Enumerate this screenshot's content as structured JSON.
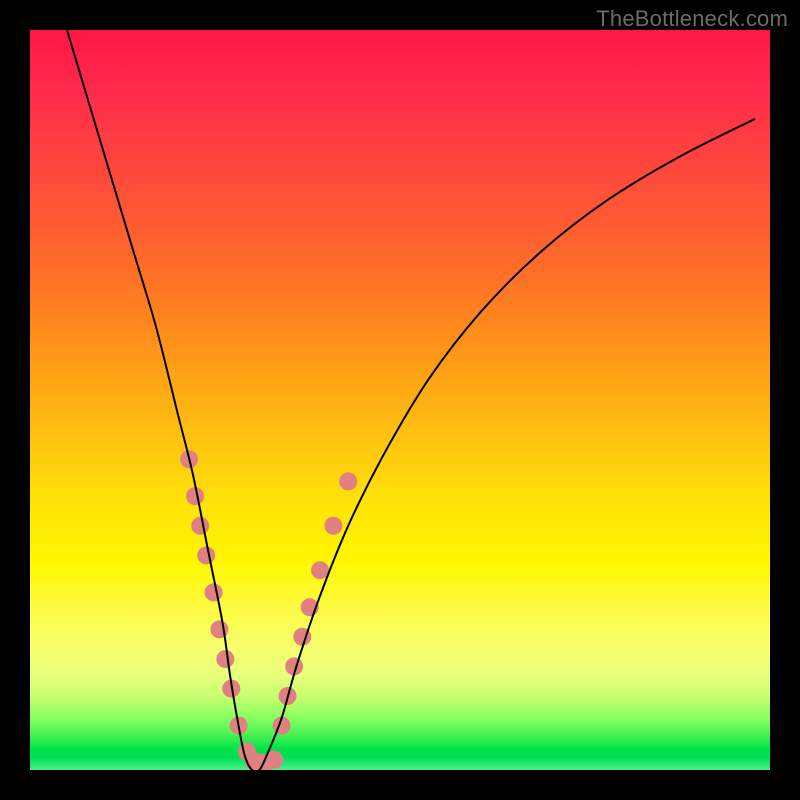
{
  "watermark": "TheBottleneck.com",
  "chart_data": {
    "type": "line",
    "title": "",
    "xlabel": "",
    "ylabel": "",
    "xlim": [
      0,
      100
    ],
    "ylim": [
      0,
      100
    ],
    "grid": false,
    "legend": false,
    "background_gradient": [
      "#ff1744",
      "#ff7a22",
      "#ffe308",
      "#00e24a"
    ],
    "series": [
      {
        "name": "bottleneck-curve",
        "x": [
          5,
          8,
          11,
          14,
          17,
          20,
          22,
          24,
          26,
          27,
          28,
          29,
          30,
          31,
          32,
          34,
          36,
          39,
          43,
          48,
          54,
          61,
          69,
          78,
          88,
          98
        ],
        "values": [
          100,
          90,
          80,
          70,
          60,
          48,
          40,
          30,
          20,
          13,
          7,
          2,
          0,
          0,
          2,
          7,
          14,
          23,
          33,
          43,
          53,
          62,
          70,
          77,
          83,
          88
        ],
        "color": "#000000",
        "stroke_width": 2
      }
    ],
    "markers": [
      {
        "name": "left-branch-dots",
        "color": "#e08080",
        "radius": 9,
        "points": [
          {
            "x": 21.5,
            "y": 42
          },
          {
            "x": 22.3,
            "y": 37
          },
          {
            "x": 23.0,
            "y": 33
          },
          {
            "x": 23.8,
            "y": 29
          },
          {
            "x": 24.8,
            "y": 24
          },
          {
            "x": 25.6,
            "y": 19
          },
          {
            "x": 26.4,
            "y": 15
          },
          {
            "x": 27.2,
            "y": 11
          },
          {
            "x": 28.2,
            "y": 6
          },
          {
            "x": 29.3,
            "y": 2.5
          }
        ]
      },
      {
        "name": "valley-dots",
        "color": "#e08080",
        "radius": 9,
        "points": [
          {
            "x": 30.2,
            "y": 1.2
          },
          {
            "x": 31.0,
            "y": 1.0
          },
          {
            "x": 31.8,
            "y": 1.0
          },
          {
            "x": 33.0,
            "y": 1.4
          }
        ]
      },
      {
        "name": "right-branch-dots",
        "color": "#e08080",
        "radius": 9,
        "points": [
          {
            "x": 34.0,
            "y": 6
          },
          {
            "x": 34.8,
            "y": 10
          },
          {
            "x": 35.7,
            "y": 14
          },
          {
            "x": 36.8,
            "y": 18
          },
          {
            "x": 37.8,
            "y": 22
          },
          {
            "x": 39.2,
            "y": 27
          },
          {
            "x": 41.0,
            "y": 33
          },
          {
            "x": 43.0,
            "y": 39
          }
        ]
      }
    ]
  }
}
